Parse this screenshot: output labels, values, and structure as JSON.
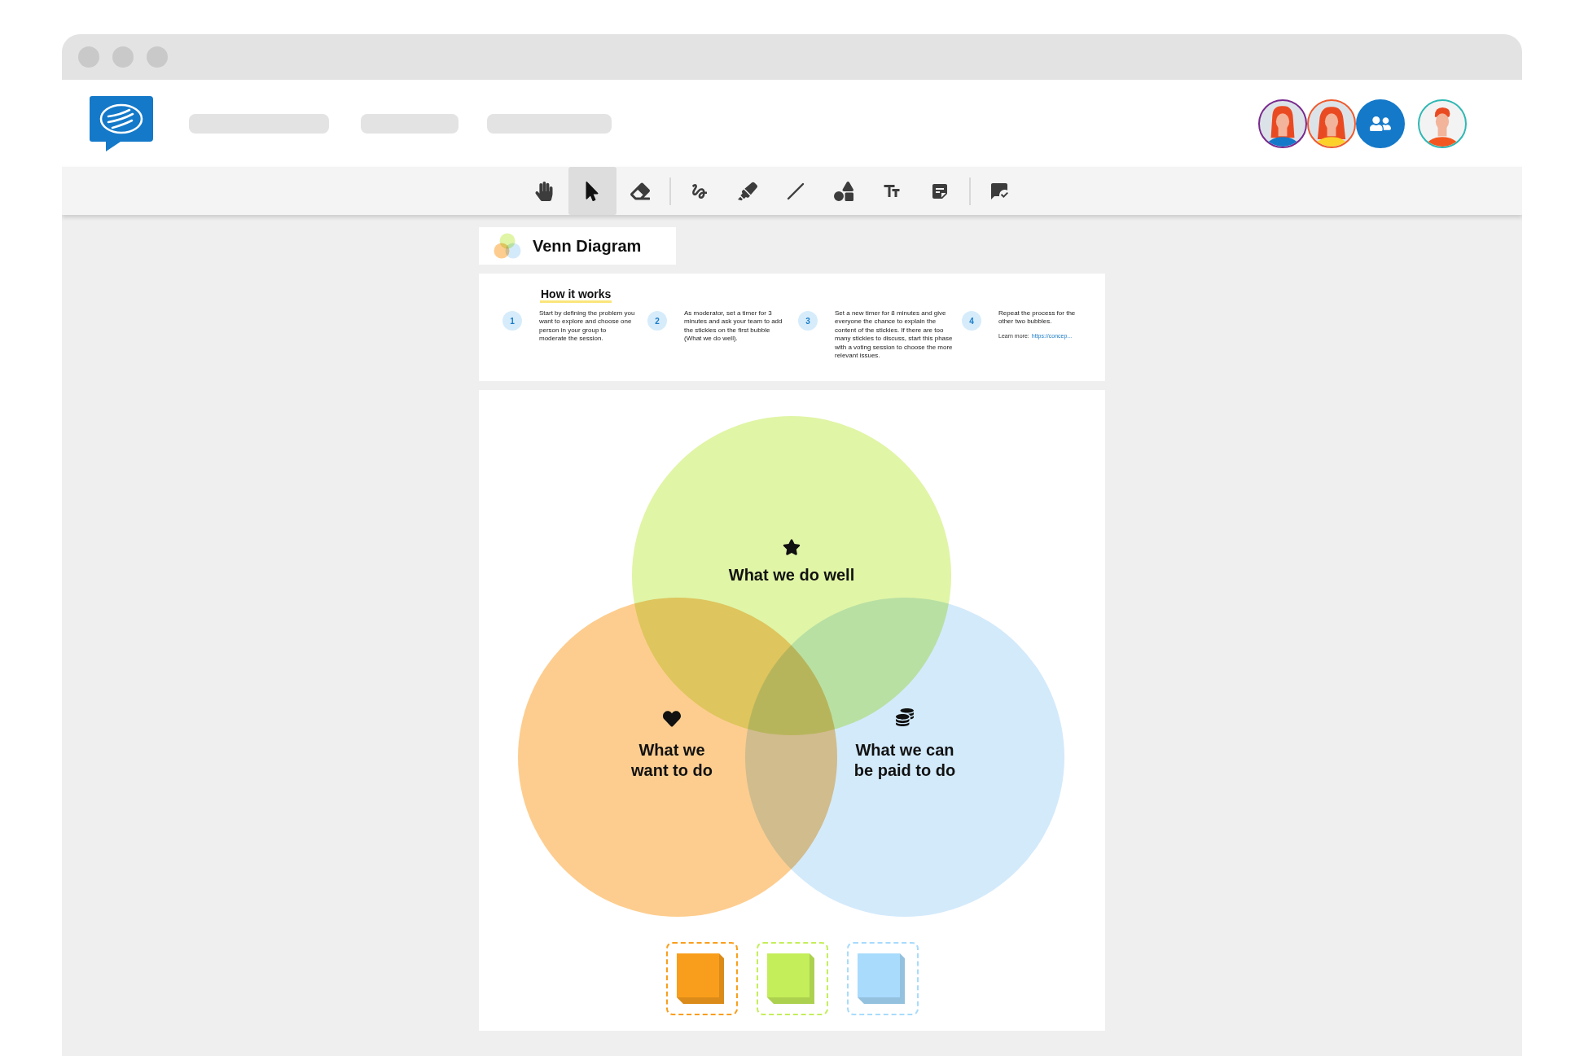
{
  "toolbar": {
    "tool_groups": [
      [
        {
          "kind": "hand",
          "selected": false
        },
        {
          "kind": "pointer",
          "selected": true
        },
        {
          "kind": "eraser",
          "selected": false
        }
      ],
      [
        {
          "kind": "pen",
          "selected": false
        },
        {
          "kind": "highlighter",
          "selected": false
        },
        {
          "kind": "line",
          "selected": false
        },
        {
          "kind": "shapes",
          "selected": false
        },
        {
          "kind": "text",
          "selected": false
        },
        {
          "kind": "sticky",
          "selected": false
        }
      ],
      [
        {
          "kind": "comment",
          "selected": false
        }
      ]
    ]
  },
  "board": {
    "title": "Venn Diagram",
    "instructions": {
      "heading": "How it works",
      "steps": [
        {
          "number": "1",
          "text": "Start by defining the problem you want to explore and choose one person in your group to moderate the session."
        },
        {
          "number": "2",
          "text": "As moderator, set a timer for 3 minutes and ask your team to add the stickies on the first bubble (What we do well)."
        },
        {
          "number": "3",
          "text": "Set a new timer for 8 minutes and give everyone the chance to explain the content of the stickies. If there are too many stickies to discuss, start this phase with a voting session to choose the more relevant issues."
        },
        {
          "number": "4",
          "text": "Repeat the process for the other two bubbles.",
          "learn_more": {
            "label": "Learn more:",
            "link": "https://concep..."
          }
        }
      ]
    },
    "venn": {
      "sets": [
        {
          "label": "What we do well",
          "kind": "star",
          "color": "#e0f5a6"
        },
        {
          "label": "What we want to do",
          "kind": "heart",
          "color": "#fdcd8f"
        },
        {
          "label": "What we can be paid to do",
          "kind": "coins",
          "color": "#d3eafb"
        }
      ]
    },
    "sticky_stacks": [
      {
        "color": "#f99e1c"
      },
      {
        "color": "#c4ee5a"
      },
      {
        "color": "#a8dbfc"
      }
    ]
  }
}
